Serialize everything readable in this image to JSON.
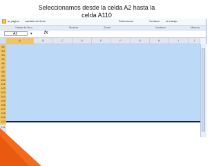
{
  "caption": "Seleccionamos desde la celda A2 hasta la celda A110",
  "ribbon": {
    "left_text": "ar página",
    "left_text2": "variable sin titulo",
    "right_text": "Seleccionar",
    "right_text2": "Ventana",
    "right_text3": "el trabajo"
  },
  "groups": [
    "Vistas de libro",
    "Mostrar",
    "Zoom",
    "Ventana",
    "Macros"
  ],
  "formula_bar": {
    "name_box": "A2",
    "fx": "fx"
  },
  "columns": [
    "A",
    "B",
    "C",
    "D",
    "E",
    "F",
    "G",
    "H",
    "I",
    "J"
  ],
  "rows": [
    "92",
    "93",
    "94",
    "95",
    "96",
    "97",
    "98",
    "99",
    "100",
    "101",
    "102",
    "103",
    "104",
    "105",
    "106",
    "107",
    "108",
    "109",
    "110",
    "111",
    "112"
  ],
  "accent_color": "#f26b1d",
  "selection_color": "#bcd9f7"
}
